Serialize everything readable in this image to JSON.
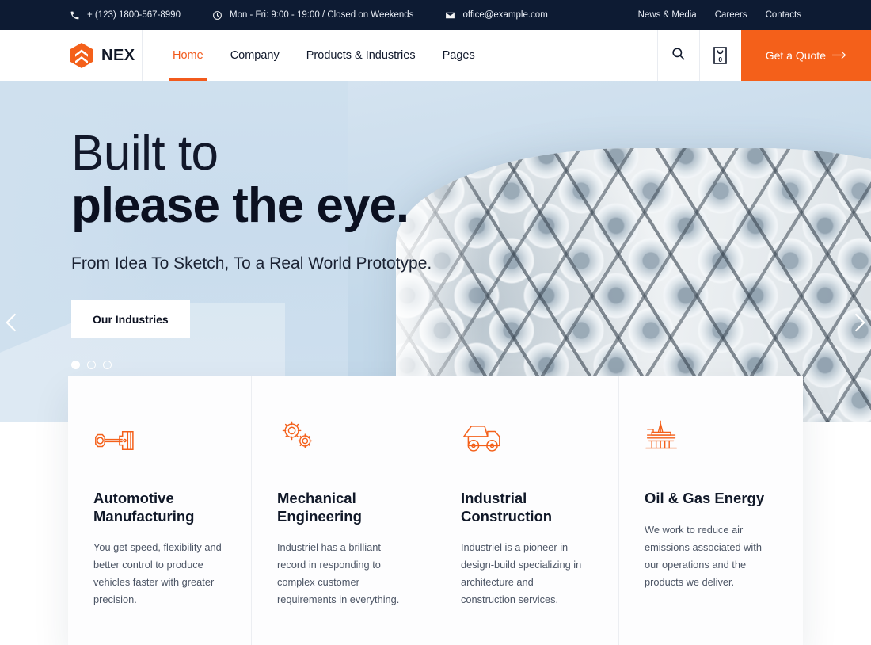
{
  "topbar": {
    "phone": {
      "icon": "phone-icon",
      "text": "+ (123) 1800-567-8990"
    },
    "hours": {
      "icon": "clock-icon",
      "text": "Mon - Fri: 9:00 - 19:00 / Closed on Weekends"
    },
    "email": {
      "icon": "mail-icon",
      "text": "office@example.com"
    },
    "links": [
      {
        "label": "News & Media"
      },
      {
        "label": "Careers"
      },
      {
        "label": "Contacts"
      }
    ]
  },
  "nav": {
    "logo_icon": "hexagon-chevron-logo-icon",
    "brand": "NEX",
    "items": [
      {
        "label": "Home",
        "active": true
      },
      {
        "label": "Company",
        "active": false
      },
      {
        "label": "Products & Industries",
        "active": false
      },
      {
        "label": "Pages",
        "active": false
      }
    ],
    "search_icon": "search-icon",
    "cart_icon": "shopping-bag-icon",
    "cart_count": "0",
    "quote_label": "Get a Quote",
    "quote_arrow": "arrow-right-icon",
    "accent_color": "#f4601a"
  },
  "hero": {
    "title_line1": "Built to",
    "title_line2": "please the eye.",
    "subtitle": "From Idea To Sketch, To a Real World Prototype.",
    "cta_label": "Our Industries",
    "prev_icon": "chevron-left-icon",
    "next_icon": "chevron-right-icon",
    "slides": [
      {
        "active": true
      },
      {
        "active": false
      },
      {
        "active": false
      }
    ]
  },
  "cards": [
    {
      "icon": "piston-icon",
      "title": "Automotive Manufacturing",
      "text": "You get speed, flexibility and better control to produce vehicles faster with greater precision."
    },
    {
      "icon": "gears-icon",
      "title": "Mechanical Engineering",
      "text": "Industriel has a brilliant record in responding to complex customer requirements in everything."
    },
    {
      "icon": "dump-truck-icon",
      "title": "Industrial Construction",
      "text": "Industriel is a pioneer in design-build specializing in architecture and construction services."
    },
    {
      "icon": "oil-rig-icon",
      "title": "Oil & Gas Energy",
      "text": "We work to reduce air emissions associated with our operations and the products we deliver."
    }
  ]
}
